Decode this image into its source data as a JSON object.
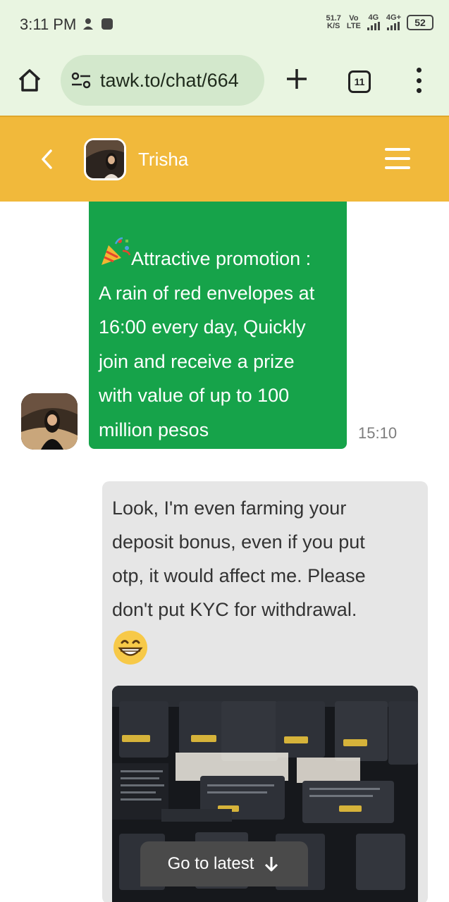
{
  "status_bar": {
    "time": "3:11 PM",
    "net_speed_value": "51.7",
    "net_speed_unit": "K/S",
    "volte_top": "Vo",
    "volte_bottom": "LTE",
    "network_1": "4G",
    "network_2": "4G+",
    "battery": "52"
  },
  "browser": {
    "url": "tawk.to/chat/664",
    "tab_count": "11",
    "icons": [
      "home-icon",
      "site-settings-icon",
      "plus-icon",
      "tabs-icon",
      "more-vert-icon"
    ]
  },
  "chat_header": {
    "agent_name": "Trisha",
    "back_icon": "chevron-left-icon",
    "menu_icon": "hamburger-menu-icon",
    "background_color": "#f1b93b"
  },
  "messages": {
    "incoming": {
      "lines": [
        "Attractive promotion :",
        "A rain of red envelopes at",
        "16:00 every day, Quickly",
        "join and receive a prize",
        "with value of up to 100",
        "million pesos"
      ],
      "time": "15:10",
      "bubble_color": "#16a34a"
    },
    "outgoing": {
      "lines": [
        "Look, I'm even farming your",
        "deposit bonus, even if you put",
        "otp, it would affect me. Please",
        "don't put KYC for withdrawal."
      ],
      "emoji": "grinning-face-emoji",
      "attachment": "screenshot-photo-image"
    }
  },
  "go_latest": {
    "label": "Go to latest",
    "icon": "arrow-down-icon"
  }
}
